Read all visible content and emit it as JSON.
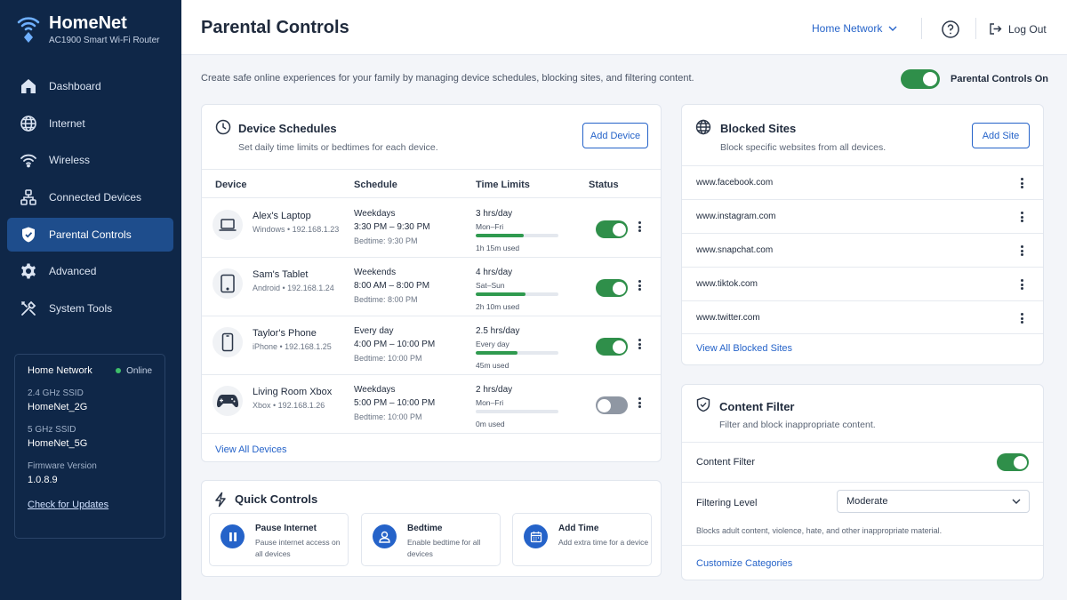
{
  "colors": {
    "sidebar": "#0f2748",
    "active_nav": "#1e4d8c",
    "accent": "#2563c9",
    "toggle_on": "#2f8f4a",
    "toggle_off": "#8f97a3",
    "usage_bar": "#2f9a4f"
  },
  "brand": {
    "name": "HomeNet",
    "subtitle": "AC1900 Smart Wi-Fi Router",
    "icon": "wifi-icon"
  },
  "nav": [
    {
      "label": "Dashboard",
      "icon": "home-icon",
      "active": false
    },
    {
      "label": "Internet",
      "icon": "globe-icon",
      "active": false
    },
    {
      "label": "Wireless",
      "icon": "wifi-icon",
      "active": false
    },
    {
      "label": "Connected Devices",
      "icon": "network-icon",
      "active": false
    },
    {
      "label": "Parental Controls",
      "icon": "shield-icon",
      "active": true
    },
    {
      "label": "Advanced",
      "icon": "gear-icon",
      "active": false
    },
    {
      "label": "System Tools",
      "icon": "tools-icon",
      "active": false
    }
  ],
  "network_card": {
    "title": "Home Network",
    "status": "Online",
    "ssid_24_label": "2.4 GHz SSID",
    "ssid_24": "HomeNet_2G",
    "ssid_5_label": "5 GHz SSID",
    "ssid_5": "HomeNet_5G",
    "firmware_label": "Firmware Version",
    "firmware": "1.0.8.9",
    "update_link": "Check for Updates"
  },
  "header": {
    "title": "Parental Controls",
    "network_selector": "Home Network",
    "logout": "Log Out"
  },
  "intro": "Create safe online experiences for your family by managing device schedules, blocking sites, and filtering content.",
  "master": {
    "label": "Parental Controls On",
    "on": true
  },
  "device_schedules": {
    "title": "Device Schedules",
    "description": "Set daily time limits or bedtimes for each device.",
    "add_button": "Add Device",
    "columns": [
      "Device",
      "Schedule",
      "Time Limits",
      "Status"
    ],
    "devices": [
      {
        "name": "Alex's Laptop",
        "meta": "Windows • 192.168.1.23",
        "icon": "laptop-icon",
        "days": "Weekdays",
        "time": "3:30 PM – 9:30 PM",
        "bedtime": "Bedtime: 9:30 PM",
        "limit": "3 hrs/day",
        "limit_days": "Mon–Fri",
        "used": "1h 15m used",
        "usage": 0.58,
        "enabled": true
      },
      {
        "name": "Sam's Tablet",
        "meta": "Android • 192.168.1.24",
        "icon": "tablet-icon",
        "days": "Weekends",
        "time": "8:00 AM – 8:00 PM",
        "bedtime": "Bedtime: 8:00 PM",
        "limit": "4 hrs/day",
        "limit_days": "Sat–Sun",
        "used": "2h 10m used",
        "usage": 0.6,
        "enabled": true
      },
      {
        "name": "Taylor's Phone",
        "meta": "iPhone • 192.168.1.25",
        "icon": "phone-icon",
        "days": "Every day",
        "time": "4:00 PM – 10:00 PM",
        "bedtime": "Bedtime: 10:00 PM",
        "limit": "2.5 hrs/day",
        "limit_days": "Every day",
        "used": "45m used",
        "usage": 0.5,
        "enabled": true
      },
      {
        "name": "Living Room Xbox",
        "meta": "Xbox • 192.168.1.26",
        "icon": "gamepad-icon",
        "days": "Weekdays",
        "time": "5:00 PM – 10:00 PM",
        "bedtime": "Bedtime: 10:00 PM",
        "limit": "2 hrs/day",
        "limit_days": "Mon–Fri",
        "used": "0m used",
        "usage": 0,
        "enabled": false
      }
    ],
    "footer_link": "View All Devices"
  },
  "quick_controls": {
    "title": "Quick Controls",
    "items": [
      {
        "name": "Pause Internet",
        "desc": "Pause internet access on all devices",
        "icon": "pause-icon"
      },
      {
        "name": "Bedtime",
        "desc": "Enable bedtime for all devices",
        "icon": "user-icon"
      },
      {
        "name": "Add Time",
        "desc": "Add extra time for a device",
        "icon": "calendar-icon"
      }
    ]
  },
  "blocked_sites": {
    "title": "Blocked Sites",
    "description": "Block specific websites from all devices.",
    "add_button": "Add Site",
    "sites": [
      "www.facebook.com",
      "www.instagram.com",
      "www.snapchat.com",
      "www.tiktok.com",
      "www.twitter.com"
    ],
    "footer_link": "View All Blocked Sites"
  },
  "content_filter": {
    "title": "Content Filter",
    "description": "Filter and block inappropriate content.",
    "toggle_label": "Content Filter",
    "enabled": true,
    "level_label": "Filtering Level",
    "level_value": "Moderate",
    "note": "Blocks adult content, violence, hate, and other inappropriate material.",
    "footer_link": "Customize Categories"
  }
}
